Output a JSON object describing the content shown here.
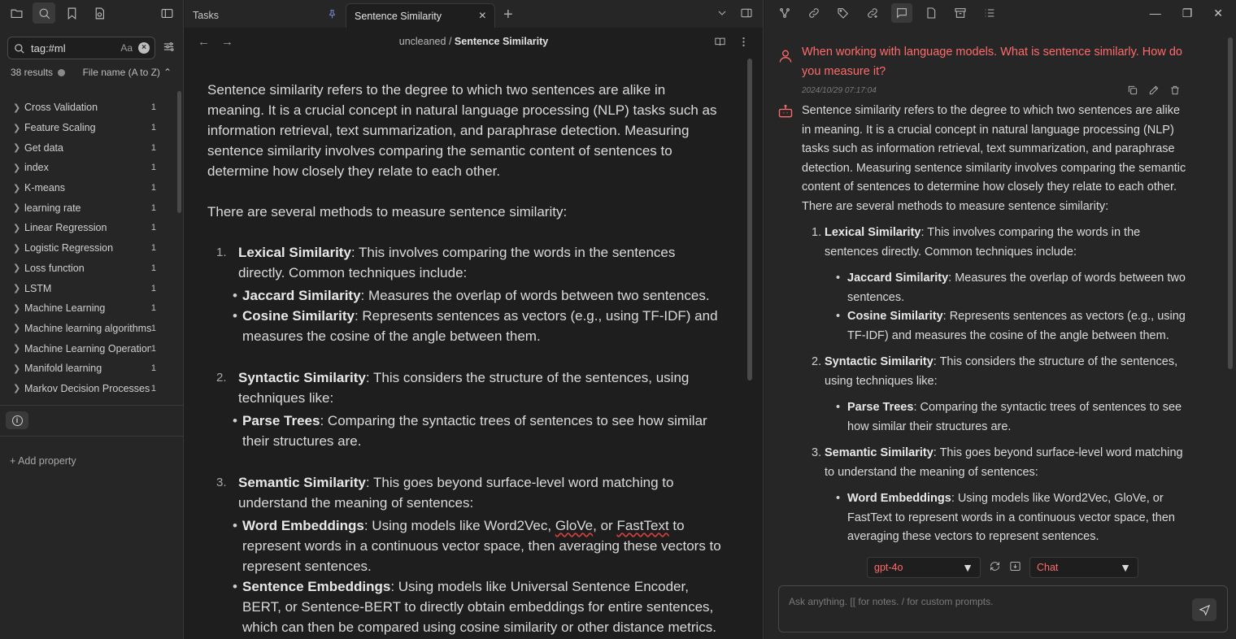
{
  "sidebar": {
    "search_value": "tag:#ml",
    "match_case_label": "Aa",
    "results_text": "38 results",
    "sort_label": "File name (A to Z)",
    "files": [
      {
        "name": "Cross Validation",
        "count": "1"
      },
      {
        "name": "Feature Scaling",
        "count": "1"
      },
      {
        "name": "Get data",
        "count": "1"
      },
      {
        "name": "index",
        "count": "1"
      },
      {
        "name": "K-means",
        "count": "1"
      },
      {
        "name": "learning rate",
        "count": "1"
      },
      {
        "name": "Linear Regression",
        "count": "1"
      },
      {
        "name": "Logistic Regression",
        "count": "1"
      },
      {
        "name": "Loss function",
        "count": "1"
      },
      {
        "name": "LSTM",
        "count": "1"
      },
      {
        "name": "Machine Learning",
        "count": "1"
      },
      {
        "name": "Machine learning algorithms",
        "count": "1"
      },
      {
        "name": "Machine Learning Operations",
        "count": "1"
      },
      {
        "name": "Manifold learning",
        "count": "1"
      },
      {
        "name": "Markov Decision Processes",
        "count": "1"
      }
    ],
    "add_property_label": "+ Add property"
  },
  "editor": {
    "tabs": [
      {
        "label": "Tasks"
      },
      {
        "label": "Sentence Similarity"
      }
    ],
    "breadcrumb_folder": "uncleaned",
    "breadcrumb_sep": "/",
    "breadcrumb_file": "Sentence Similarity",
    "intro": "Sentence similarity refers to the degree to which two sentences are alike in meaning. It is a crucial concept in natural language processing (NLP) tasks such as information retrieval, text summarization, and paraphrase detection. Measuring sentence similarity involves comparing the semantic content of sentences to determine how closely they relate to each other.",
    "methods_intro": "There are several methods to measure sentence similarity:",
    "m1_num": "1.",
    "m1_title": "Lexical Similarity",
    "m1_text": ": This involves comparing the words in the sentences directly. Common techniques include:",
    "m1_b1_title": "Jaccard Similarity",
    "m1_b1_text": ": Measures the overlap of words between two sentences.",
    "m1_b2_title": "Cosine Similarity",
    "m1_b2_text": ": Represents sentences as vectors (e.g., using TF-IDF) and measures the cosine of the angle between them.",
    "m2_num": "2.",
    "m2_title": "Syntactic Similarity",
    "m2_text": ": This considers the structure of the sentences, using techniques like:",
    "m2_b1_title": "Parse Trees",
    "m2_b1_text": ": Comparing the syntactic trees of sentences to see how similar their structures are.",
    "m3_num": "3.",
    "m3_title": "Semantic Similarity",
    "m3_text": ": This goes beyond surface-level word matching to understand the meaning of sentences:",
    "m3_b1_title": "Word Embeddings",
    "m3_b1_text_a": ": Using models like Word2Vec, ",
    "m3_b1_glove": "GloVe",
    "m3_b1_text_b": ", or ",
    "m3_b1_fasttext": "FastText",
    "m3_b1_text_c": " to represent words in a continuous vector space, then averaging these vectors to represent sentences.",
    "m3_b2_title": "Sentence Embeddings",
    "m3_b2_text": ": Using models like Universal Sentence Encoder, BERT, or Sentence-BERT to directly obtain embeddings for entire sentences, which can then be compared using cosine similarity or other distance metrics."
  },
  "chat": {
    "user_message": "When working with language models. What is sentence similarly. How do you measure it?",
    "timestamp": "2024/10/29 07:17:04",
    "bot_intro": "Sentence similarity refers to the degree to which two sentences are alike in meaning. It is a crucial concept in natural language processing (NLP) tasks such as information retrieval, text summarization, and paraphrase detection. Measuring sentence similarity involves comparing the semantic content of sentences to determine how closely they relate to each other.",
    "bot_methods_intro": "There are several methods to measure sentence similarity:",
    "m1_num": "1.",
    "m1_title": "Lexical Similarity",
    "m1_text": ": This involves comparing the words in the sentences directly. Common techniques include:",
    "m1_b1_title": "Jaccard Similarity",
    "m1_b1_text": ": Measures the overlap of words between two sentences.",
    "m1_b2_title": "Cosine Similarity",
    "m1_b2_text": ": Represents sentences as vectors (e.g., using TF-IDF) and measures the cosine of the angle between them.",
    "m2_num": "2.",
    "m2_title": "Syntactic Similarity",
    "m2_text": ": This considers the structure of the sentences, using techniques like:",
    "m2_b1_title": "Parse Trees",
    "m2_b1_text": ": Comparing the syntactic trees of sentences to see how similar their structures are.",
    "m3_num": "3.",
    "m3_title": "Semantic Similarity",
    "m3_text": ": This goes beyond surface-level word matching to understand the meaning of sentences:",
    "m3_b1_title": "Word Embeddings",
    "m3_b1_text": ": Using models like Word2Vec, GloVe, or FastText to represent words in a continuous vector space, then averaging these vectors to represent sentences.",
    "model_select": "gpt-4o",
    "mode_select": "Chat",
    "input_placeholder": "Ask anything. [[ for notes. / for custom prompts.",
    "user_color": "#ff6b6b"
  }
}
